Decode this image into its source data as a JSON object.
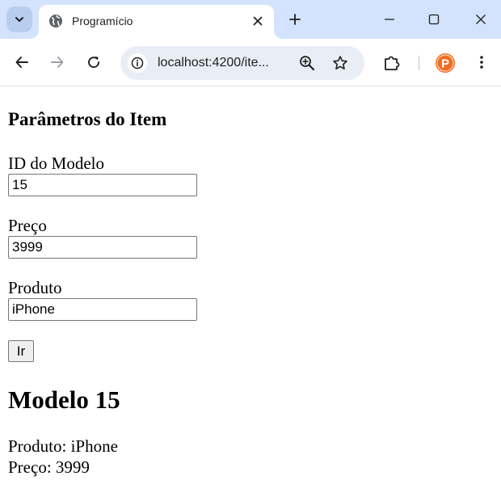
{
  "browser": {
    "tab_title": "Programício",
    "url": "localhost:4200/ite...",
    "profile_initial": "P"
  },
  "colors": {
    "tabstrip_bg": "#d3e3fd",
    "omnibox_bg": "#e9eef6",
    "profile_orange": "#f36b21"
  },
  "icons": {
    "tab_search": "chevron-down-icon",
    "favicon": "globe-icon",
    "tab_close": "close-icon",
    "new_tab": "plus-icon",
    "minimize": "minimize-icon",
    "maximize": "maximize-icon",
    "close_window": "close-icon",
    "back": "arrow-left-icon",
    "forward": "arrow-right-icon",
    "reload": "reload-icon",
    "site_info": "site-info-icon",
    "zoom": "zoom-in-icon",
    "bookmark": "star-icon",
    "extensions": "puzzle-icon",
    "menu": "kebab-icon"
  },
  "page": {
    "heading": "Parâmetros do Item",
    "fields": {
      "model_id": {
        "label": "ID do Modelo",
        "value": "15"
      },
      "price": {
        "label": "Preço",
        "value": "3999"
      },
      "product": {
        "label": "Produto",
        "value": "iPhone"
      }
    },
    "submit_label": "Ir",
    "result": {
      "title": "Modelo 15",
      "product_line": "Produto: iPhone",
      "price_line": "Preço: 3999"
    }
  }
}
